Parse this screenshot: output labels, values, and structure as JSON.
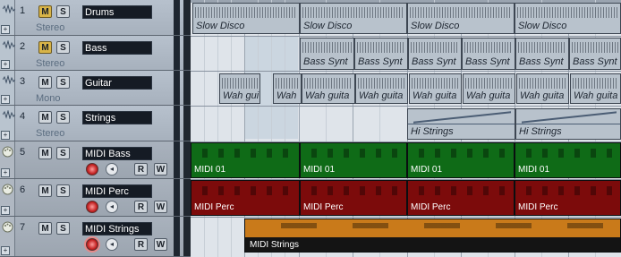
{
  "tracks": [
    {
      "num": "1",
      "name": "Drums",
      "sub": "Stereo",
      "mute": "M",
      "solo": "S",
      "type": "audio"
    },
    {
      "num": "2",
      "name": "Bass",
      "sub": "Stereo",
      "mute": "M",
      "solo": "S",
      "type": "audio"
    },
    {
      "num": "3",
      "name": "Guitar",
      "sub": "Mono",
      "mute": "M",
      "solo": "S",
      "type": "audio"
    },
    {
      "num": "4",
      "name": "Strings",
      "sub": "Stereo",
      "mute": "M",
      "solo": "S",
      "type": "audio"
    },
    {
      "num": "5",
      "name": "MIDI Bass",
      "mute": "M",
      "solo": "S",
      "read": "R",
      "write": "W",
      "type": "midi"
    },
    {
      "num": "6",
      "name": "MIDI Perc",
      "mute": "M",
      "solo": "S",
      "read": "R",
      "write": "W",
      "type": "midi"
    },
    {
      "num": "7",
      "name": "MIDI Strings",
      "mute": "M",
      "solo": "S",
      "read": "R",
      "write": "W",
      "type": "midi"
    }
  ],
  "arrange": {
    "drums_parts": [
      "Slow Disco",
      "Slow Disco",
      "Slow Disco",
      "Slow Disco"
    ],
    "bass_parts": [
      "Bass Synt",
      "Bass Synt",
      "Bass Synt",
      "Bass Synt",
      "Bass Synt",
      "Bass Synt"
    ],
    "guitar_parts": [
      "Wah gui",
      "Wah",
      "Wah guita",
      "Wah guita",
      "Wah guita",
      "Wah guita",
      "Wah guita",
      "Wah guita"
    ],
    "strings_parts": [
      "Hi Strings",
      "Hi Strings"
    ],
    "midibass_parts": [
      "MIDI 01",
      "MIDI 01",
      "MIDI 01",
      "MIDI 01"
    ],
    "midiperc_parts": [
      "MIDI Perc",
      "MIDI Perc",
      "MIDI Perc",
      "MIDI Perc"
    ],
    "midistrings_part": "MIDI Strings"
  },
  "colors": {
    "midi_bass": "#0f6b17",
    "midi_perc": "#7c0b0b",
    "midi_strings": "#c97a1a",
    "mute_active": "#d8b448"
  },
  "icons": {
    "audio_track": "waveform-icon",
    "midi_track": "midi-knob-icon",
    "expand": "plus-icon",
    "record": "record-icon",
    "monitor": "monitor-speaker-icon"
  }
}
